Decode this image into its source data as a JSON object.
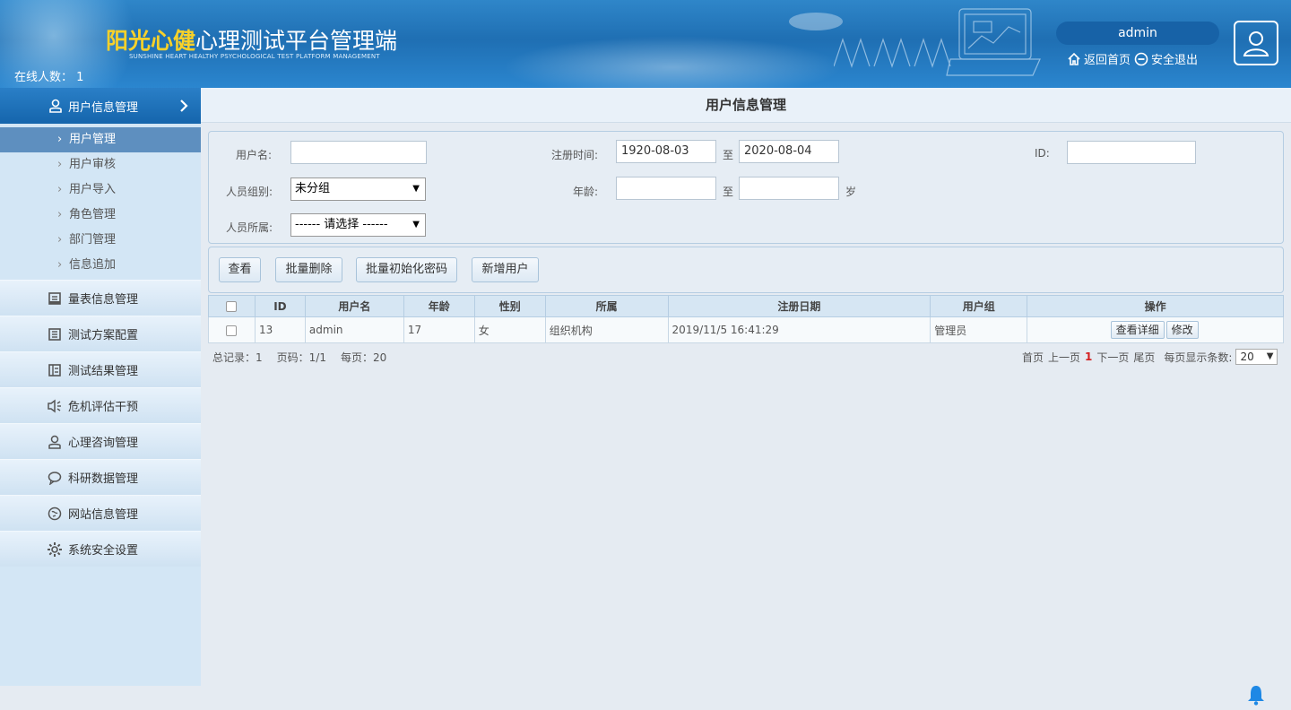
{
  "header": {
    "brand_highlight": "阳光心健",
    "brand_rest": "心理测试平台管理端",
    "brand_sub": "SUNSHINE HEART HEALTHY PSYCHOLOGICAL TEST PLATFORM MANAGEMENT",
    "online_label": "在线人数：",
    "online_count": "1",
    "username": "admin",
    "home_link": "返回首页",
    "logout_link": "安全退出",
    "icons": [
      "home-icon",
      "logout-icon",
      "user-avatar-icon"
    ]
  },
  "sidebar": {
    "active_section": "用户信息管理",
    "sub_items": [
      {
        "label": "用户管理",
        "active": true
      },
      {
        "label": "用户审核"
      },
      {
        "label": "用户导入"
      },
      {
        "label": "角色管理"
      },
      {
        "label": "部门管理"
      },
      {
        "label": "信息追加"
      }
    ],
    "sections": [
      {
        "label": "量表信息管理",
        "icon": "form-icon"
      },
      {
        "label": "测试方案配置",
        "icon": "book-icon"
      },
      {
        "label": "测试结果管理",
        "icon": "results-icon"
      },
      {
        "label": "危机评估干预",
        "icon": "speaker-icon"
      },
      {
        "label": "心理咨询管理",
        "icon": "person-icon"
      },
      {
        "label": "科研数据管理",
        "icon": "chat-bubble-icon"
      },
      {
        "label": "网站信息管理",
        "icon": "globe-icon"
      },
      {
        "label": "系统安全设置",
        "icon": "gear-icon"
      }
    ]
  },
  "main": {
    "title": "用户信息管理",
    "filters": {
      "username_label": "用户名:",
      "username_value": "",
      "reg_time_label": "注册时间:",
      "reg_from": "1920-08-03",
      "to_label": "至",
      "reg_to": "2020-08-04",
      "id_label": "ID:",
      "id_value": "",
      "group_label": "人员组别:",
      "group_value": "未分组",
      "age_label": "年龄:",
      "age_from": "",
      "age_to": "",
      "age_unit": "岁",
      "belong_label": "人员所属:",
      "belong_value": "------ 请选择 ------"
    },
    "buttons": {
      "view": "查看",
      "batch_delete": "批量删除",
      "batch_reset_pwd": "批量初始化密码",
      "add_user": "新增用户"
    },
    "table": {
      "columns": [
        "ID",
        "用户名",
        "年龄",
        "性别",
        "所属",
        "注册日期",
        "用户组",
        "操作"
      ],
      "rows": [
        {
          "id": "13",
          "username": "admin",
          "age": "17",
          "gender": "女",
          "belong": "组织机构",
          "reg_date": "2019/11/5 16:41:29",
          "group": "管理员",
          "actions": [
            "查看详细",
            "修改"
          ]
        }
      ]
    },
    "pager": {
      "total": "总记录：1",
      "page": "页码：1/1",
      "per_page": "每页：20",
      "first": "首页",
      "prev": "上一页",
      "current": "1",
      "next": "下一页",
      "last": "尾页",
      "per_page_label": "每页显示条数:",
      "per_page_value": "20"
    }
  },
  "colors": {
    "header_blue": "#1f6fb3",
    "brand_yellow": "#f7d12a",
    "sidebar_active": "#1565ac",
    "sub_active": "#5e8fbf",
    "current_page_red": "#d42020",
    "bell_blue": "#1e88e5"
  }
}
